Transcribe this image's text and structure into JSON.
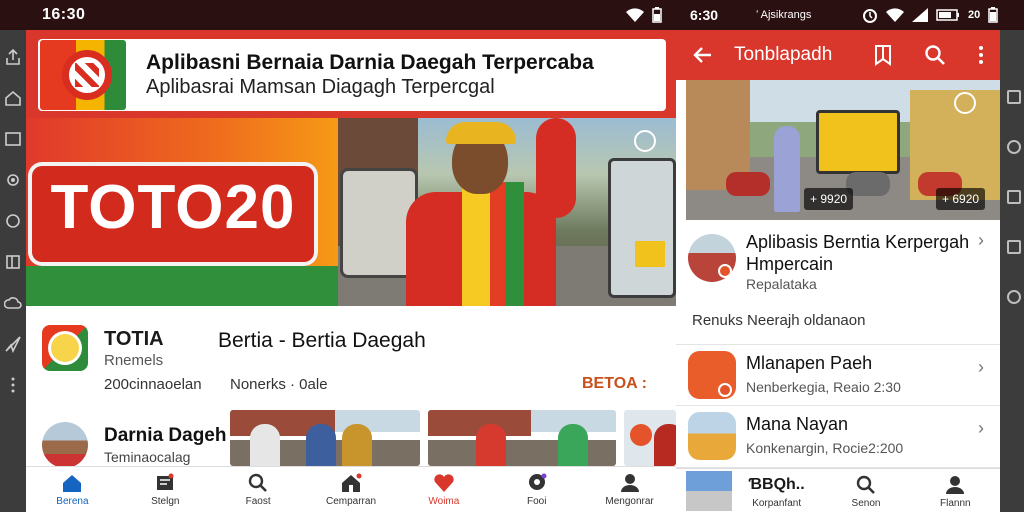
{
  "status": {
    "time_left": "16:30",
    "time_right": "6:30",
    "carrier": "ʻ Ajsikrangs",
    "battery_pct": "20"
  },
  "left_app": {
    "banner": {
      "line1": "Aplibasni Bernaia Darnia Daegah Terpercaba",
      "line2": "Aplibasrai Mamsan Diagagh Terpercgal"
    },
    "hero_sign": "TOTO20",
    "app": {
      "name": "TOTIA",
      "subtitle": "Rnemels",
      "downloads": "200cinnaoelan",
      "title": "Bertia - Bertia Daegah",
      "meta": "Nonerks · 0ale",
      "action": "BETOA :"
    },
    "second": {
      "name": "Darnia Dageh",
      "subtitle": "Teminaocalag"
    },
    "nav": [
      {
        "label": "Berena",
        "icon": "home-icon"
      },
      {
        "label": "Stelgn",
        "icon": "news-icon"
      },
      {
        "label": "Faost",
        "icon": "search-icon"
      },
      {
        "label": "Cemparran",
        "icon": "house-icon"
      },
      {
        "label": "Woima",
        "icon": "heart-icon"
      },
      {
        "label": "Fooi",
        "icon": "pin-icon"
      },
      {
        "label": "Mengonrar",
        "icon": "profile-icon"
      }
    ]
  },
  "right_app": {
    "title": "Tonblapadh",
    "tags": [
      "+ 9920",
      "+ 6920"
    ],
    "rows": [
      {
        "title": "Aplibasis Berntia Kerpergah Hmpercain",
        "sub": "Repalataka"
      },
      {
        "title": "Mlanapen Paeh",
        "sub": "Nenberkegia, Reaio 2:30"
      },
      {
        "title": "Mana Nayan",
        "sub": "Konkenargin, Rocie2:200"
      }
    ],
    "note": "Renuks Neerajh oldanaon",
    "nav_logo": "ƁBQh..",
    "nav": [
      {
        "label": "Korpanfant",
        "icon": "logo-icon"
      },
      {
        "label": "Senon",
        "icon": "search-icon"
      },
      {
        "label": "Flannn",
        "icon": "profile-icon"
      }
    ]
  },
  "colors": {
    "brand_red": "#d9362c",
    "link_orange": "#c8501d",
    "active_blue": "#1565c0"
  }
}
